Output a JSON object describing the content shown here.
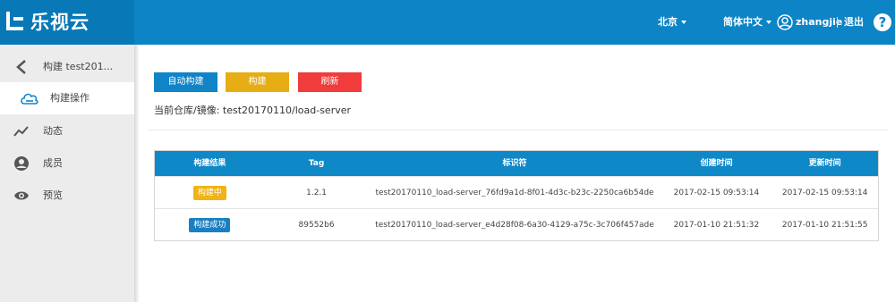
{
  "brand": {
    "name": "乐视云",
    "logo_icon": "letv-logo-icon"
  },
  "header": {
    "region": "北京",
    "language": "简体中文",
    "username": "zhangjie",
    "logout": "退出",
    "help": "?"
  },
  "sidebar": {
    "back_label": "构建 test201...",
    "items": [
      {
        "label": "构建操作",
        "icon": "cloud-icon",
        "active": true
      },
      {
        "label": "动态",
        "icon": "activity-line-icon"
      },
      {
        "label": "成员",
        "icon": "person-icon"
      },
      {
        "label": "预览",
        "icon": "eye-icon"
      }
    ]
  },
  "actions": {
    "auto_build": "自动构建",
    "build": "构建",
    "refresh": "刷新"
  },
  "repo_line": "当前仓库/镜像: test20170110/load-server",
  "table": {
    "headers": [
      "构建结果",
      "Tag",
      "标识符",
      "创建时间",
      "更新时间"
    ],
    "rows": [
      {
        "status": "构建中",
        "tag": "1.2.1",
        "id": "test20170110_load-server_76fd9a1d-8f01-4d3c-b23c-2250ca6b54de",
        "created": "2017-02-15 09:53:14",
        "updated": "2017-02-15 09:53:14"
      },
      {
        "status": "构建成功",
        "tag": "89552b6",
        "id": "test20170110_load-server_e4d28f08-6a30-4129-a75c-3c706f457ade",
        "created": "2017-01-10 21:51:32",
        "updated": "2017-01-10 21:51:55"
      }
    ]
  },
  "colors": {
    "header_blue": "#0d84c6",
    "building_badge": "#f1b315",
    "success_badge": "#1a7fc1",
    "refresh_button": "#f03c3c",
    "build_button": "#e6ae14"
  }
}
